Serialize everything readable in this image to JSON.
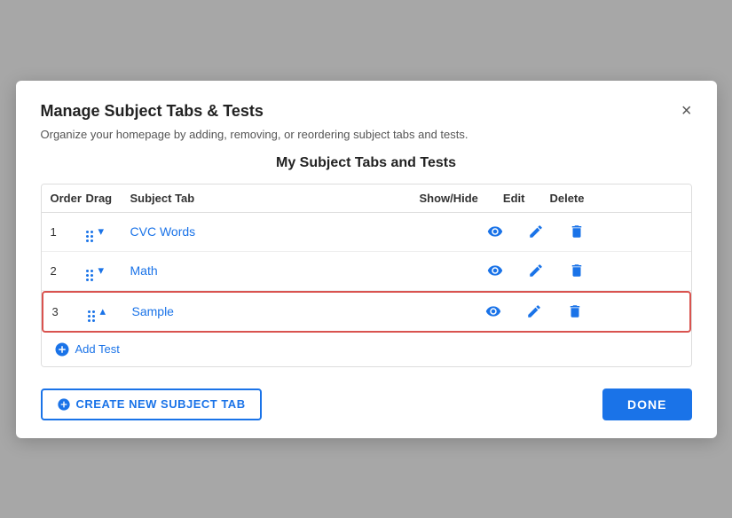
{
  "modal": {
    "title": "Manage Subject Tabs & Tests",
    "close_label": "×",
    "subtitle": "Organize your homepage by adding, removing, or reordering subject tabs and tests.",
    "section_title": "My Subject Tabs and Tests"
  },
  "table": {
    "headers": {
      "order": "Order",
      "drag": "Drag",
      "subject_tab": "Subject Tab",
      "show_hide": "Show/Hide",
      "edit": "Edit",
      "delete": "Delete"
    },
    "rows": [
      {
        "order": "1",
        "label": "CVC Words",
        "chevron": "▾",
        "highlighted": false
      },
      {
        "order": "2",
        "label": "Math",
        "chevron": "▾",
        "highlighted": false
      },
      {
        "order": "3",
        "label": "Sample",
        "chevron": "▴",
        "highlighted": true
      }
    ],
    "add_test_label": "Add Test"
  },
  "footer": {
    "create_btn_label": "CREATE NEW SUBJECT TAB",
    "done_btn_label": "DONE"
  }
}
